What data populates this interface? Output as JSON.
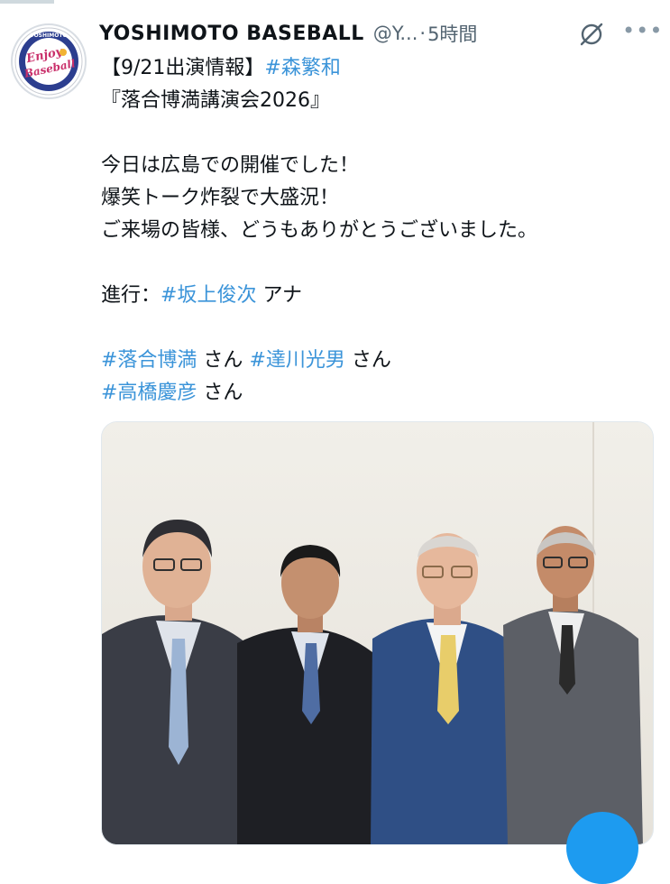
{
  "account": {
    "display_name": "YOSHIMOTO BASEBALL",
    "handle": "@Y...",
    "separator": "·",
    "time": "5時間",
    "avatar_logo_text": "Enjoy Baseball",
    "avatar_ring_text": "YOSHIMOTO"
  },
  "icons": {
    "grok": "grok-icon",
    "more": "more-icon",
    "more_glyph": "•••"
  },
  "tweet": {
    "line1_prefix": "【9/21出演情報】",
    "line1_tag": "#森繁和",
    "line2": "『落合博満講演会2026』",
    "line3": "今日は広島での開催でした！",
    "line4": "爆笑トーク炸裂で大盛況！",
    "line5": "ご来場の皆様、どうもありがとうございました。",
    "line6_prefix": "進行：",
    "line6_tag": "#坂上俊次",
    "line6_suffix": " アナ",
    "tag_a": "#落合博満",
    "tag_a_suffix": " さん ",
    "tag_b": "#達川光男",
    "tag_b_suffix": " さん",
    "tag_c": "#高橋慶彦",
    "tag_c_suffix": " さん"
  },
  "colors": {
    "hashtag": "#3b94d9",
    "text": "#0f1419",
    "muted": "#536471",
    "fab": "#1d9bf0"
  }
}
